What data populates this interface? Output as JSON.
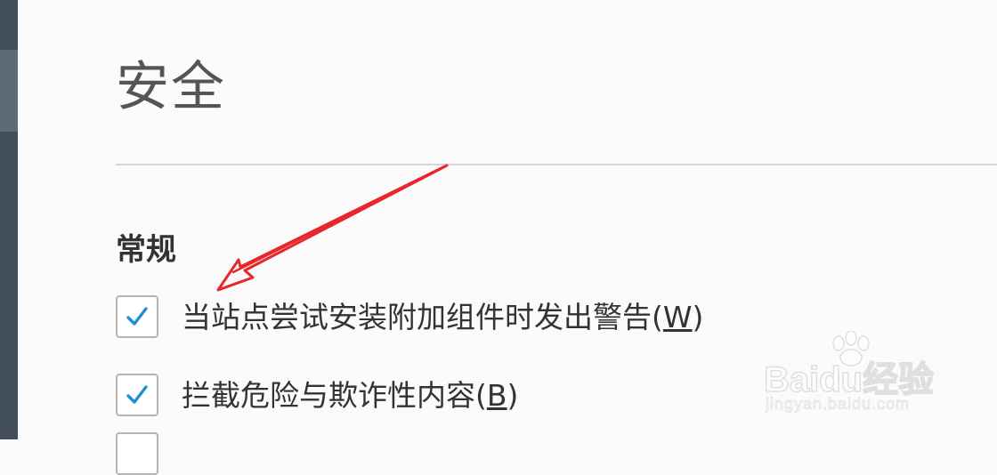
{
  "page": {
    "title": "安全",
    "section_heading": "常规"
  },
  "options": [
    {
      "label": "当站点尝试安装附加组件时发出警告",
      "accesskey": "W",
      "checked": true
    },
    {
      "label": "拦截危险与欺诈性内容",
      "accesskey": "B",
      "checked": true
    },
    {
      "label": "",
      "accesskey": "",
      "checked": false
    }
  ],
  "annotation": {
    "color": "#e8262b",
    "icon": "red-arrow-annotation"
  },
  "watermark": {
    "logo_text": "Baidu经验",
    "url": "jingyan.baidu.com"
  },
  "colors": {
    "sidebar": "#424f5a",
    "check": "#1d8fd6",
    "divider": "#d6d6d6"
  }
}
